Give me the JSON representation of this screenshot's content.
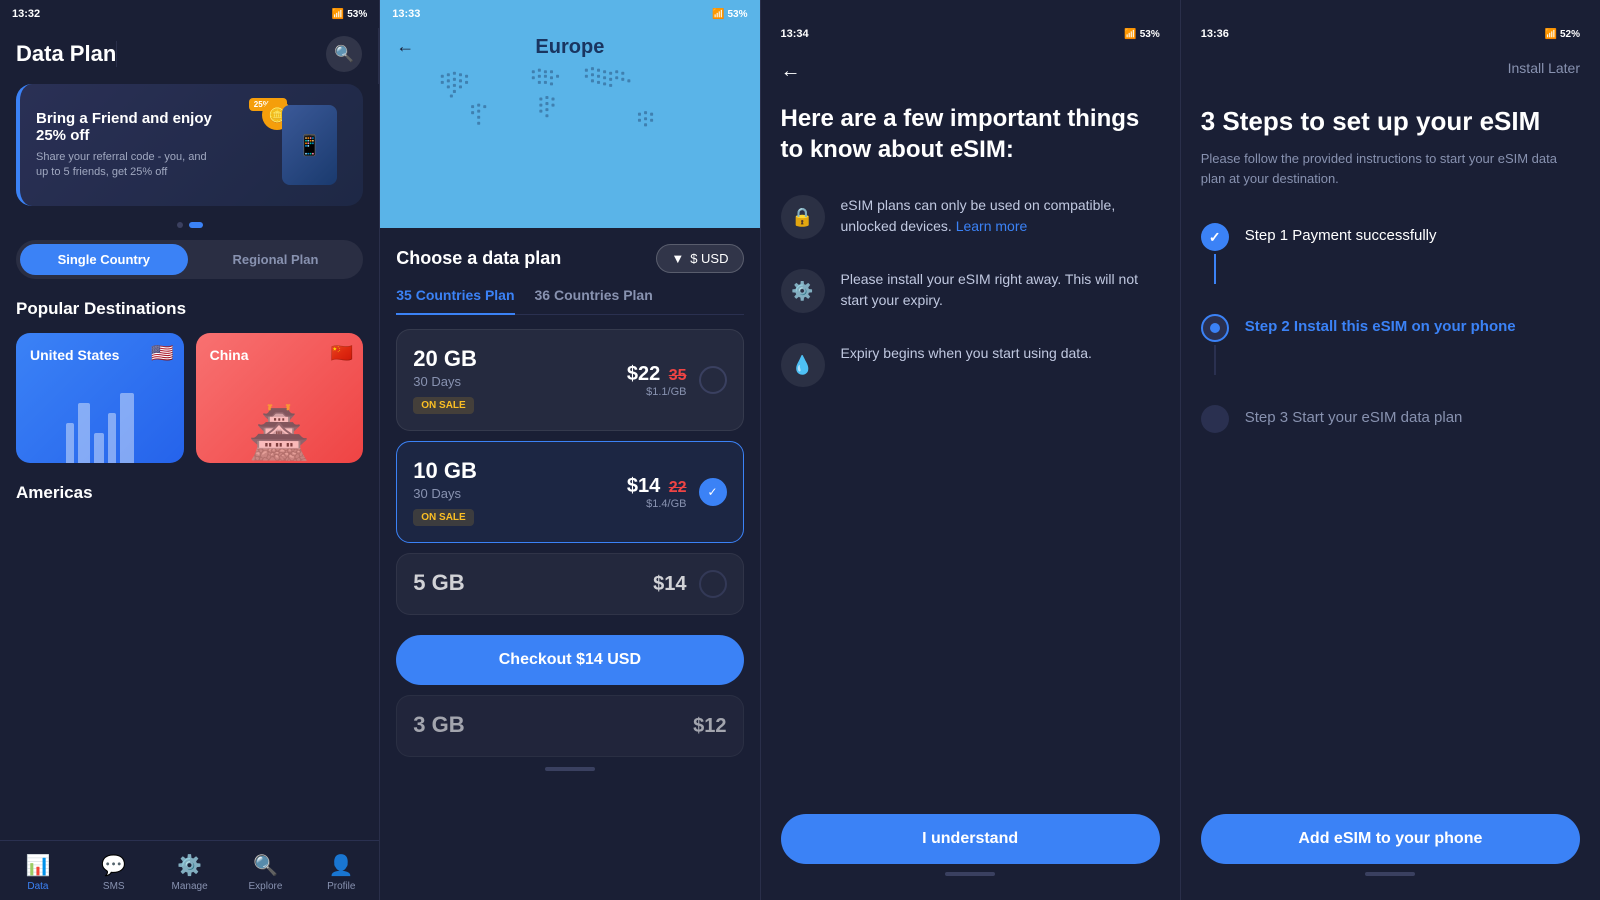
{
  "screen1": {
    "status_time": "13:32",
    "status_battery": "53%",
    "title": "Data Plan",
    "promo": {
      "title": "Bring a Friend and enjoy 25% off",
      "description": "Share your referral code - you, and up to 5 friends, get 25% off",
      "badge": "25% off"
    },
    "tabs": {
      "single": "Single Country",
      "regional": "Regional Plan"
    },
    "popular_heading": "Popular Destinations",
    "destinations": [
      {
        "name": "United States",
        "flag": "🇺🇸",
        "color": "us"
      },
      {
        "name": "China",
        "flag": "🇨🇳",
        "color": "cn"
      }
    ],
    "americas_heading": "Americas",
    "nav": [
      {
        "label": "Data",
        "icon": "📊",
        "active": true
      },
      {
        "label": "SMS",
        "icon": "💬",
        "active": false
      },
      {
        "label": "Manage",
        "icon": "⚙️",
        "active": false
      },
      {
        "label": "Explore",
        "icon": "🔍",
        "active": false
      },
      {
        "label": "Profile",
        "icon": "👤",
        "active": false
      }
    ]
  },
  "screen2": {
    "status_time": "13:33",
    "status_battery": "53%",
    "region_title": "Europe",
    "plan_section_title": "Choose a data plan",
    "currency_label": "$ USD",
    "tabs": [
      {
        "label": "35 Countries Plan",
        "active": true
      },
      {
        "label": "36 Countries Plan",
        "active": false
      }
    ],
    "plans": [
      {
        "gb": "20 GB",
        "days": "30 Days",
        "price_new": "$22",
        "price_old": "35",
        "per_gb": "$1.1/GB",
        "on_sale": true,
        "selected": false
      },
      {
        "gb": "10 GB",
        "days": "30 Days",
        "price_new": "$14",
        "price_old": "22",
        "per_gb": "$1.4/GB",
        "on_sale": true,
        "selected": true
      },
      {
        "gb": "5 GB",
        "days": "",
        "price_new": "$14",
        "price_old": "",
        "per_gb": "",
        "on_sale": false,
        "selected": false
      },
      {
        "gb": "3 GB",
        "days": "",
        "price_new": "$12",
        "price_old": "",
        "per_gb": "",
        "on_sale": false,
        "selected": false
      }
    ],
    "checkout_label": "Checkout $14 USD",
    "on_sale_text": "ON SALE"
  },
  "screen3": {
    "status_time": "13:34",
    "status_battery": "53%",
    "heading": "Here are a few important things to know about eSIM:",
    "info_items": [
      {
        "icon": "🔒",
        "text": "eSIM plans can only be used on compatible, unlocked devices.",
        "link_text": "Learn more"
      },
      {
        "icon": "⚙️",
        "text": "Please install your eSIM right away. This will not start your expiry."
      },
      {
        "icon": "💧",
        "text": "Expiry begins when you start using data."
      }
    ],
    "button_label": "I understand"
  },
  "screen4": {
    "status_time": "13:36",
    "status_battery": "52%",
    "install_later": "Install Later",
    "heading": "3 Steps to set up your eSIM",
    "description": "Please follow the provided instructions to start your eSIM data plan at your destination.",
    "steps": [
      {
        "label": "Step 1 Payment successfully",
        "state": "done"
      },
      {
        "label": "Step 2 Install this eSIM on your phone",
        "state": "current"
      },
      {
        "label": "Step 3 Start your eSIM data plan",
        "state": "pending"
      }
    ],
    "button_label": "Add eSIM to your phone"
  }
}
